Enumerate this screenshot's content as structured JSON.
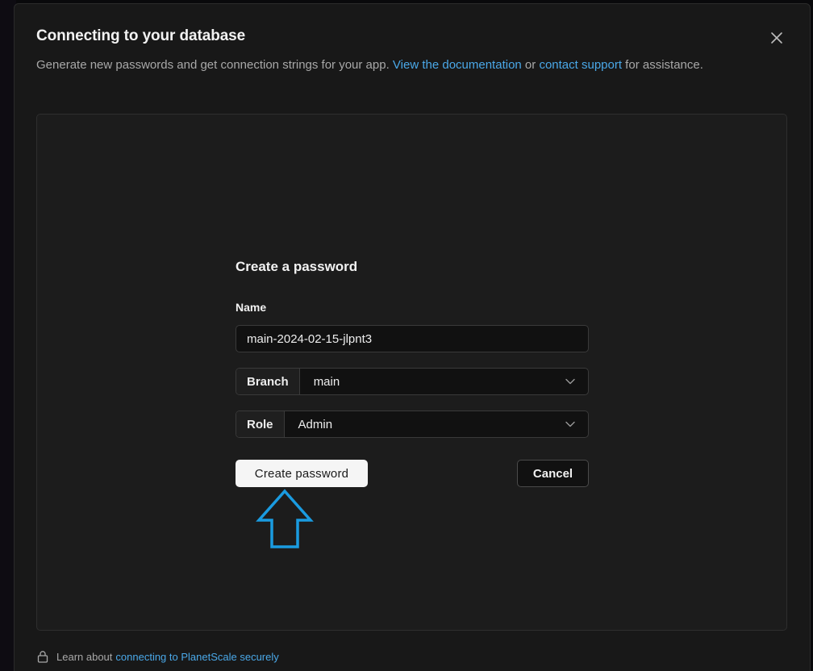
{
  "modal": {
    "title": "Connecting to your database",
    "description_prefix": "Generate new passwords and get connection strings for your app. ",
    "docs_link": "View the documentation",
    "description_or": " or ",
    "support_link": "contact support",
    "description_suffix": " for assistance."
  },
  "form": {
    "title": "Create a password",
    "name_label": "Name",
    "name_value": "main-2024-02-15-jlpnt3",
    "branch_label": "Branch",
    "branch_value": "main",
    "role_label": "Role",
    "role_value": "Admin",
    "create_button": "Create password",
    "cancel_button": "Cancel"
  },
  "footer": {
    "text": "Learn about",
    "link": "connecting to PlanetScale securely"
  },
  "colors": {
    "link": "#4aa8e8",
    "annotation_arrow": "#1a9be0",
    "modal_bg": "#181818",
    "panel_bg": "#1c1c1c"
  },
  "icons": {
    "close": "close-icon",
    "chevron": "chevron-down-icon",
    "lock": "lock-icon",
    "annotation": "up-arrow-icon"
  }
}
